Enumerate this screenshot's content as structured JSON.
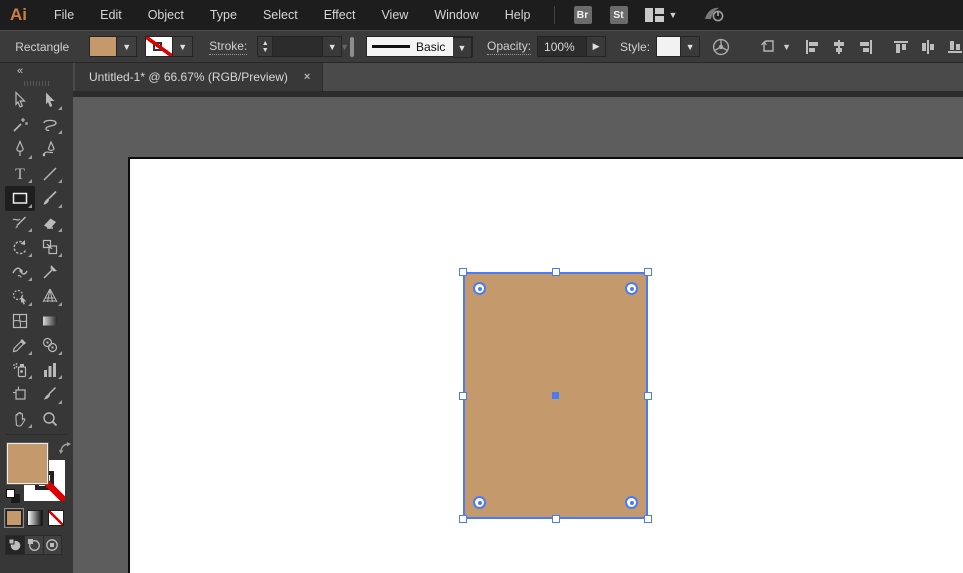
{
  "app": {
    "logo": "Ai",
    "name": "Adobe Illustrator"
  },
  "menubar": {
    "items": [
      "File",
      "Edit",
      "Object",
      "Type",
      "Select",
      "Effect",
      "View",
      "Window",
      "Help"
    ],
    "bridge_label": "Br",
    "stock_label": "St",
    "icons": [
      "workspace-switcher-icon",
      "gpu-performance-icon"
    ]
  },
  "controlbar": {
    "selection_label": "Rectangle",
    "fill_color": "#C49A6C",
    "stroke_color": "none",
    "stroke_label": "Stroke:",
    "stroke_weight_value": "",
    "variable_width_profile": "",
    "brush_definition": "Basic",
    "opacity_label": "Opacity:",
    "opacity_value": "100%",
    "style_label": "Style:",
    "icons": [
      "recolor-artwork-icon",
      "shape-properties-icon",
      "align-left-icon",
      "align-center-icon",
      "align-right-icon",
      "align-top-icon",
      "align-middle-icon",
      "align-bottom-icon"
    ]
  },
  "document_tab": {
    "title": "Untitled-1* @ 66.67% (RGB/Preview)",
    "close_label": "×"
  },
  "toolbar": {
    "collapse_label": "«",
    "selected_tool": "rectangle",
    "tools": [
      "selection",
      "direct-selection",
      "magic-wand",
      "lasso",
      "pen",
      "curvature",
      "type",
      "line-segment",
      "rectangle",
      "paintbrush",
      "shaper",
      "eraser",
      "rotate",
      "scale",
      "width",
      "puppet-warp",
      "shape-builder",
      "perspective-grid",
      "mesh",
      "gradient",
      "eyedropper",
      "blend",
      "symbol-sprayer",
      "column-graph",
      "artboard",
      "slice",
      "hand",
      "zoom"
    ],
    "fill_color": "#C49A6C",
    "stroke_color": "none",
    "draw_modes": [
      "draw-normal",
      "draw-behind",
      "draw-inside"
    ],
    "selected_draw_mode": "draw-normal"
  },
  "canvas": {
    "pasteboard_color": "#5d5d5d",
    "artboard_color": "#ffffff",
    "selection_color": "#4a7bf7",
    "selected_object": {
      "type": "rectangle",
      "fill": "#C49A6C",
      "stroke": "none"
    }
  }
}
